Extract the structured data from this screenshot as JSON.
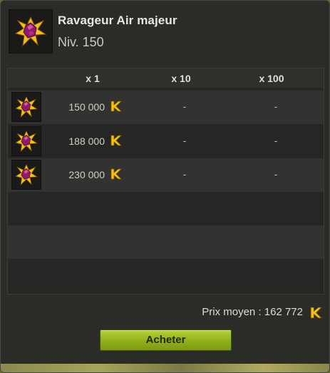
{
  "item": {
    "name": "Ravageur Air majeur",
    "level": "Niv. 150",
    "icon": "ravageur-gem-icon"
  },
  "table": {
    "headers": [
      "x 1",
      "x 10",
      "x 100"
    ],
    "rows": [
      {
        "price_x1": "150 000",
        "price_x10": "-",
        "price_x100": "-"
      },
      {
        "price_x1": "188 000",
        "price_x10": "-",
        "price_x100": "-"
      },
      {
        "price_x1": "230 000",
        "price_x10": "-",
        "price_x100": "-"
      }
    ],
    "empty_rows": 4
  },
  "summary": {
    "average_price": "Prix moyen : 162 772"
  },
  "actions": {
    "buy_label": "Acheter"
  },
  "colors": {
    "panel": "#2b2b28",
    "kama": "#f2c21b",
    "buy_button": "#8fb01c"
  },
  "icons": {
    "currency": "kama-icon"
  }
}
